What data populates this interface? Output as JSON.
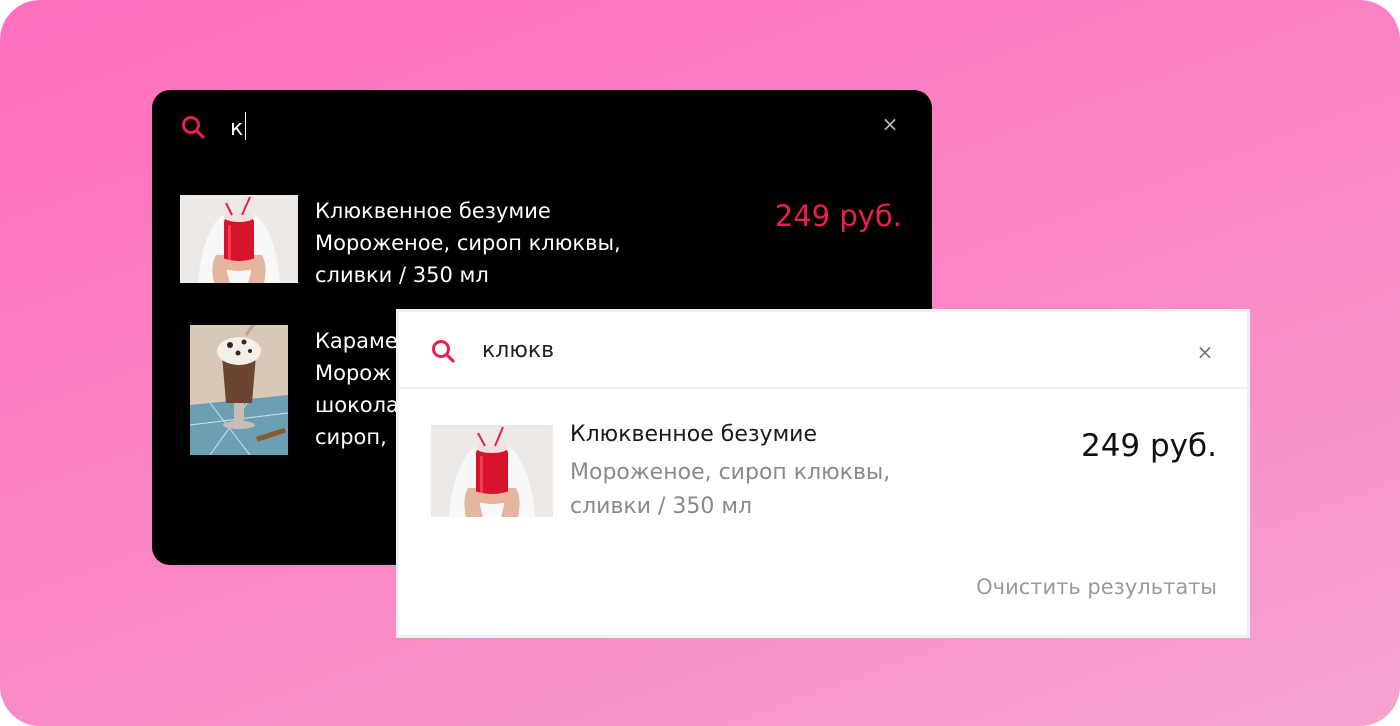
{
  "colors": {
    "accent": "#e8204b",
    "dark_bg": "#000000",
    "light_bg": "#ffffff",
    "muted": "#8a8a8a"
  },
  "dark_widget": {
    "query": "к",
    "close_icon": "close-icon",
    "results": [
      {
        "title": "Клюквенное безумие",
        "desc_line1": "Мороженое, сироп клюквы,",
        "desc_line2": "сливки / 350 мл",
        "price": "249 руб."
      },
      {
        "title": "Караме",
        "desc_line1": "Морож",
        "desc_line2": "шокола",
        "desc_line3": "сироп,"
      }
    ]
  },
  "light_widget": {
    "query": "клюкв",
    "close_icon": "close-icon",
    "result": {
      "title": "Клюквенное безумие",
      "desc_line1": "Мороженое, сироп клюквы,",
      "desc_line2": "сливки / 350 мл",
      "price": "249 руб."
    },
    "clear_label": "Очистить результаты"
  }
}
